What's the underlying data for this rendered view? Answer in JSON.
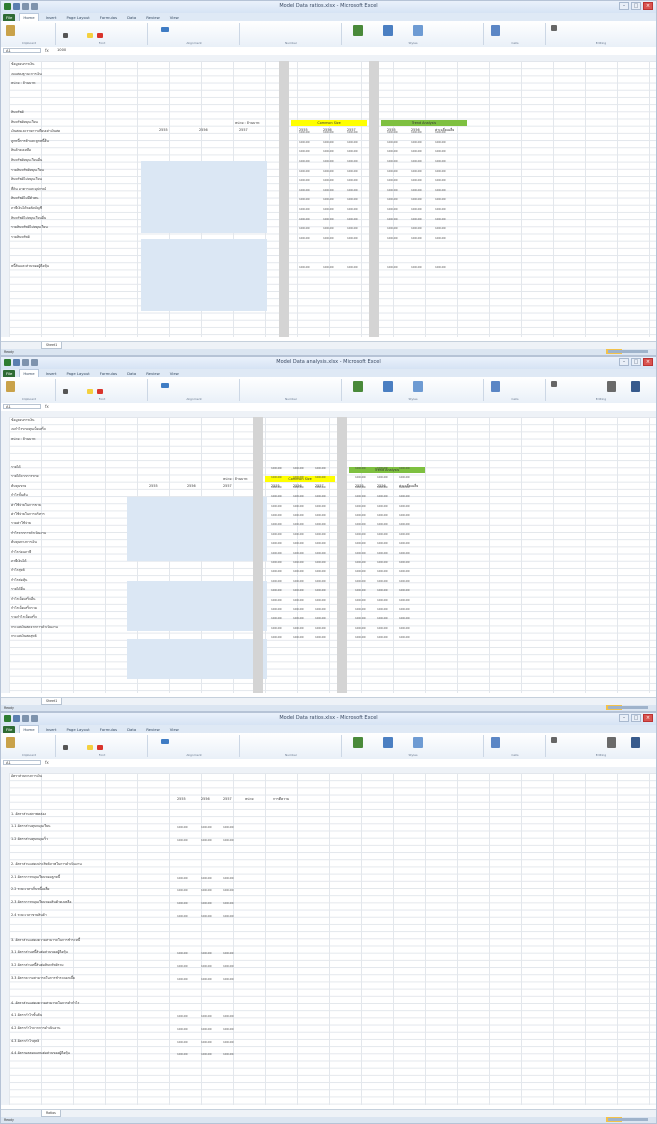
{
  "windows": [
    {
      "title": "Model Data ratios.xlsx - Microsoft Excel",
      "tabs": [
        "File",
        "Home",
        "Insert",
        "Page Layout",
        "Formulas",
        "Data",
        "Review",
        "View"
      ],
      "ribbon_groups": [
        "Clipboard",
        "Font",
        "Alignment",
        "Number",
        "Styles",
        "Cells",
        "Editing"
      ],
      "namebox": "A1",
      "formula": "1000",
      "rows": [
        "ข้อมูลงบการเงิน",
        "งบแสดงฐานะการเงิน",
        "หน่วย : ล้านบาท",
        "",
        "",
        "สินทรัพย์",
        "สินทรัพย์หมุนเวียน",
        "เงินสดและรายการเทียบเท่าเงินสด",
        "ลูกหนี้การค้าและลูกหนี้อื่น",
        "สินค้าคงเหลือ",
        "สินทรัพย์หมุนเวียนอื่น",
        "รวมสินทรัพย์หมุนเวียน",
        "สินทรัพย์ไม่หมุนเวียน",
        "ที่ดิน อาคารและอุปกรณ์",
        "สินทรัพย์ไม่มีตัวตน",
        "ภาษีเงินได้รอตัดบัญชี",
        "สินทรัพย์ไม่หมุนเวียนอื่น",
        "รวมสินทรัพย์ไม่หมุนเวียน",
        "รวมสินทรัพย์",
        "",
        "",
        "หนี้สินและส่วนของผู้ถือหุ้น"
      ],
      "years": [
        "2555",
        "2556",
        "2557"
      ],
      "unit_label": "หน่วย : ล้านบาท",
      "yellow_header": "Common Size",
      "green_header": "Trend Analysis",
      "sub_headers": [
        "2555",
        "2556",
        "2557",
        "2555",
        "2556",
        "ค่าเฉลี่ยเฉลี่ย"
      ],
      "sample_value": "100.00",
      "sheet_tab": "Sheet1",
      "status": "Ready"
    },
    {
      "title": "Model Data analysis.xlsx - Microsoft Excel",
      "tabs": [
        "File",
        "Home",
        "Insert",
        "Page Layout",
        "Formulas",
        "Data",
        "Review",
        "View"
      ],
      "ribbon_groups": [
        "Clipboard",
        "Font",
        "Alignment",
        "Number",
        "Styles",
        "Cells",
        "Editing"
      ],
      "namebox": "A1",
      "formula": "",
      "rows": [
        "ข้อมูลงบการเงิน",
        "งบกำไรขาดทุนเบ็ดเสร็จ",
        "หน่วย : ล้านบาท",
        "",
        "",
        "รายได้",
        "รายได้จากการขาย",
        "ต้นทุนขาย",
        "กำไรขั้นต้น",
        "ค่าใช้จ่ายในการขาย",
        "ค่าใช้จ่ายในการบริหาร",
        "รวมค่าใช้จ่าย",
        "กำไรจากการดำเนินงาน",
        "ต้นทุนทางการเงิน",
        "กำไรก่อนภาษี",
        "ภาษีเงินได้",
        "กำไรสุทธิ",
        "กำไรต่อหุ้น",
        "รายได้อื่น",
        "กำไรเบ็ดเสร็จอื่น",
        "กำไรเบ็ดเสร็จรวม",
        "รวมกำไรเบ็ดเสร็จ",
        "กระแสเงินสดจากการดำเนินงาน",
        "กระแสเงินสดสุทธิ"
      ],
      "years": [
        "2555",
        "2556",
        "2557"
      ],
      "unit_label": "หน่วย : ล้านบาท",
      "yellow_header": "Common Size",
      "green_header": "Trend Analysis",
      "sub_headers": [
        "2555",
        "2556",
        "2557",
        "2555",
        "2556",
        "ค่าเฉลี่ยเฉลี่ย"
      ],
      "sample_value": "100.00",
      "sheet_tab": "Sheet1",
      "status": "Ready"
    },
    {
      "title": "Model Data ratios.xlsx - Microsoft Excel",
      "tabs": [
        "File",
        "Home",
        "Insert",
        "Page Layout",
        "Formulas",
        "Data",
        "Review",
        "View"
      ],
      "ribbon_groups": [
        "Clipboard",
        "Font",
        "Alignment",
        "Number",
        "Styles",
        "Cells",
        "Editing"
      ],
      "namebox": "A1",
      "formula": "",
      "rows": [
        "อัตราส่วนทางการเงิน",
        "",
        "",
        "1. อัตราส่วนสภาพคล่อง",
        "1.1 อัตราส่วนทุนหมุนเวียน",
        "1.2 อัตราส่วนทุนหมุนเร็ว",
        "",
        "2. อัตราส่วนแสดงประสิทธิภาพในการดำเนินงาน",
        "2.1 อัตราการหมุนเวียนของลูกหนี้",
        "2.2 ระยะเวลาเก็บหนี้เฉลี่ย",
        "2.3 อัตราการหมุนเวียนของสินค้าคงเหลือ",
        "2.4 ระยะเวลาขายสินค้า",
        "",
        "3. อัตราส่วนแสดงความสามารถในการชำระหนี้",
        "3.1 อัตราส่วนหนี้สินต่อส่วนของผู้ถือหุ้น",
        "3.2 อัตราส่วนหนี้สินต่อสินทรัพย์รวม",
        "3.3 อัตราความสามารถในการชำระดอกเบี้ย",
        "",
        "4. อัตราส่วนแสดงความสามารถในการทำกำไร",
        "4.1 อัตรากำไรขั้นต้น",
        "4.2 อัตรากำไรจากการดำเนินงาน",
        "4.3 อัตรากำไรสุทธิ",
        "4.4 อัตราผลตอบแทนต่อส่วนของผู้ถือหุ้น"
      ],
      "col_headers": [
        "2555",
        "2556",
        "2557",
        "หน่วย",
        "การตีความ"
      ],
      "sample_value": "100.00",
      "sheet_tab": "Ratios",
      "status": "Ready"
    }
  ]
}
